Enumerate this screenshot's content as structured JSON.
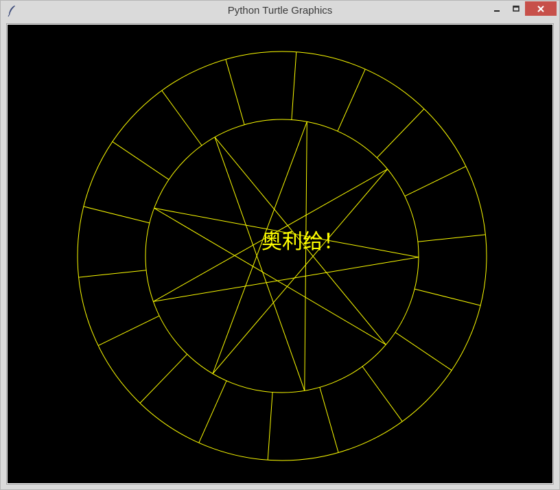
{
  "window": {
    "title": "Python Turtle Graphics",
    "icons": {
      "app": "feather-icon",
      "minimize": "minimize-icon",
      "maximize": "maximize-icon",
      "close": "close-icon"
    }
  },
  "canvas": {
    "background_color": "#000000",
    "stroke_color": "#ffff00",
    "text": "奥利给！",
    "drawing": {
      "outer_ring_segments": 18,
      "inner_star_points": 9,
      "star_step": 4
    }
  },
  "colors": {
    "titlebar": "#dadada",
    "close_button": "#c7504a"
  }
}
